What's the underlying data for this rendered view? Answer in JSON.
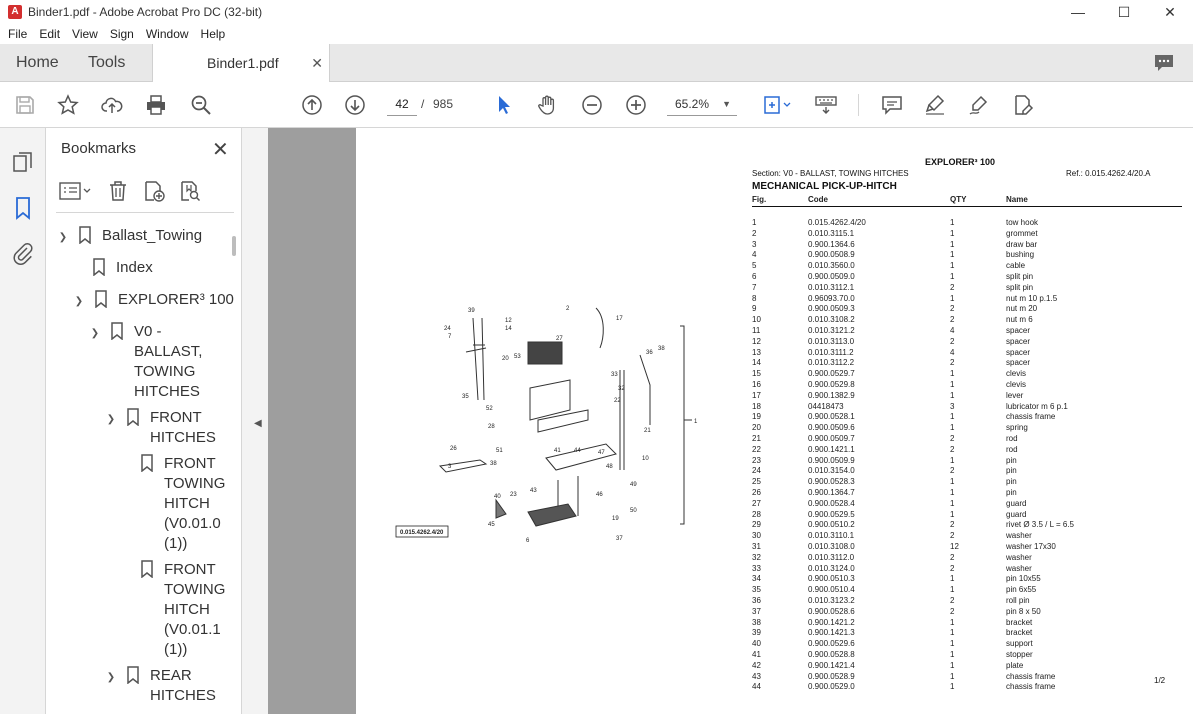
{
  "window": {
    "title": "Binder1.pdf - Adobe Acrobat Pro DC (32-bit)"
  },
  "menu": [
    "File",
    "Edit",
    "View",
    "Sign",
    "Window",
    "Help"
  ],
  "tabs": {
    "home": "Home",
    "tools": "Tools",
    "document": "Binder1.pdf"
  },
  "toolbar": {
    "page_current": "42",
    "page_separator": "/",
    "page_total": "985",
    "zoom": "65.2%"
  },
  "bookmarks": {
    "title": "Bookmarks",
    "items": [
      {
        "label": "Ballast_Towing"
      },
      {
        "label": "Index"
      },
      {
        "label": "EXPLORER³ 100"
      },
      {
        "label": "V0 -\nBALLAST,\nTOWING\nHITCHES"
      },
      {
        "label": "FRONT\nHITCHES"
      },
      {
        "label": "FRONT\nTOWING\nHITCH\n(V0.01.0\n(1))"
      },
      {
        "label": "FRONT\nTOWING\nHITCH\n(V0.01.1\n(1))"
      },
      {
        "label": "REAR\nHITCHES"
      }
    ]
  },
  "document": {
    "model": "EXPLORER³ 100",
    "section": "Section: V0 - BALLAST, TOWING HITCHES",
    "ref": "Ref.: 0.015.4262.4/20.A",
    "heading": "MECHANICAL PICK-UP-HITCH",
    "columns": {
      "fig": "Fig.",
      "code": "Code",
      "qty": "QTY",
      "name": "Name"
    },
    "drawing_ref": "0.015.4262.4/20",
    "page_label": "1/2",
    "parts": [
      {
        "fig": "1",
        "code": "0.015.4262.4/20",
        "qty": "1",
        "name": "tow hook"
      },
      {
        "fig": "2",
        "code": "0.010.3115.1",
        "qty": "1",
        "name": "grommet"
      },
      {
        "fig": "3",
        "code": "0.900.1364.6",
        "qty": "1",
        "name": "draw bar"
      },
      {
        "fig": "4",
        "code": "0.900.0508.9",
        "qty": "1",
        "name": "bushing"
      },
      {
        "fig": "5",
        "code": "0.010.3560.0",
        "qty": "1",
        "name": "cable"
      },
      {
        "fig": "6",
        "code": "0.900.0509.0",
        "qty": "1",
        "name": "split pin"
      },
      {
        "fig": "7",
        "code": "0.010.3112.1",
        "qty": "2",
        "name": "split pin"
      },
      {
        "fig": "8",
        "code": "0.96093.70.0",
        "qty": "1",
        "name": "nut m 10 p.1.5"
      },
      {
        "fig": "9",
        "code": "0.900.0509.3",
        "qty": "2",
        "name": "nut m 20"
      },
      {
        "fig": "10",
        "code": "0.010.3108.2",
        "qty": "2",
        "name": "nut m 6"
      },
      {
        "fig": "11",
        "code": "0.010.3121.2",
        "qty": "4",
        "name": "spacer"
      },
      {
        "fig": "12",
        "code": "0.010.3113.0",
        "qty": "2",
        "name": "spacer"
      },
      {
        "fig": "13",
        "code": "0.010.3111.2",
        "qty": "4",
        "name": "spacer"
      },
      {
        "fig": "14",
        "code": "0.010.3112.2",
        "qty": "2",
        "name": "spacer"
      },
      {
        "fig": "15",
        "code": "0.900.0529.7",
        "qty": "1",
        "name": "clevis"
      },
      {
        "fig": "16",
        "code": "0.900.0529.8",
        "qty": "1",
        "name": "clevis"
      },
      {
        "fig": "17",
        "code": "0.900.1382.9",
        "qty": "1",
        "name": "lever"
      },
      {
        "fig": "18",
        "code": "04418473",
        "qty": "3",
        "name": "lubricator m 6 p.1"
      },
      {
        "fig": "19",
        "code": "0.900.0528.1",
        "qty": "1",
        "name": "chassis frame"
      },
      {
        "fig": "20",
        "code": "0.900.0509.6",
        "qty": "1",
        "name": "spring"
      },
      {
        "fig": "21",
        "code": "0.900.0509.7",
        "qty": "2",
        "name": "rod"
      },
      {
        "fig": "22",
        "code": "0.900.1421.1",
        "qty": "2",
        "name": "rod"
      },
      {
        "fig": "23",
        "code": "0.900.0509.9",
        "qty": "1",
        "name": "pin"
      },
      {
        "fig": "24",
        "code": "0.010.3154.0",
        "qty": "2",
        "name": "pin"
      },
      {
        "fig": "25",
        "code": "0.900.0528.3",
        "qty": "1",
        "name": "pin"
      },
      {
        "fig": "26",
        "code": "0.900.1364.7",
        "qty": "1",
        "name": "pin"
      },
      {
        "fig": "27",
        "code": "0.900.0528.4",
        "qty": "1",
        "name": "guard"
      },
      {
        "fig": "28",
        "code": "0.900.0529.5",
        "qty": "1",
        "name": "guard"
      },
      {
        "fig": "29",
        "code": "0.900.0510.2",
        "qty": "2",
        "name": "rivet Ø 3.5 / L = 6.5"
      },
      {
        "fig": "30",
        "code": "0.010.3110.1",
        "qty": "2",
        "name": "washer"
      },
      {
        "fig": "31",
        "code": "0.010.3108.0",
        "qty": "12",
        "name": "washer 17x30"
      },
      {
        "fig": "32",
        "code": "0.010.3112.0",
        "qty": "2",
        "name": "washer"
      },
      {
        "fig": "33",
        "code": "0.010.3124.0",
        "qty": "2",
        "name": "washer"
      },
      {
        "fig": "34",
        "code": "0.900.0510.3",
        "qty": "1",
        "name": "pin 10x55"
      },
      {
        "fig": "35",
        "code": "0.900.0510.4",
        "qty": "1",
        "name": "pin 6x55"
      },
      {
        "fig": "36",
        "code": "0.010.3123.2",
        "qty": "2",
        "name": "roll pin"
      },
      {
        "fig": "37",
        "code": "0.900.0528.6",
        "qty": "2",
        "name": "pin 8 x 50"
      },
      {
        "fig": "38",
        "code": "0.900.1421.2",
        "qty": "1",
        "name": "bracket"
      },
      {
        "fig": "39",
        "code": "0.900.1421.3",
        "qty": "1",
        "name": "bracket"
      },
      {
        "fig": "40",
        "code": "0.900.0529.6",
        "qty": "1",
        "name": "support"
      },
      {
        "fig": "41",
        "code": "0.900.0528.8",
        "qty": "1",
        "name": "stopper"
      },
      {
        "fig": "42",
        "code": "0.900.1421.4",
        "qty": "1",
        "name": "plate"
      },
      {
        "fig": "43",
        "code": "0.900.0528.9",
        "qty": "1",
        "name": "chassis frame"
      },
      {
        "fig": "44",
        "code": "0.900.0529.0",
        "qty": "1",
        "name": "chassis frame"
      }
    ]
  }
}
